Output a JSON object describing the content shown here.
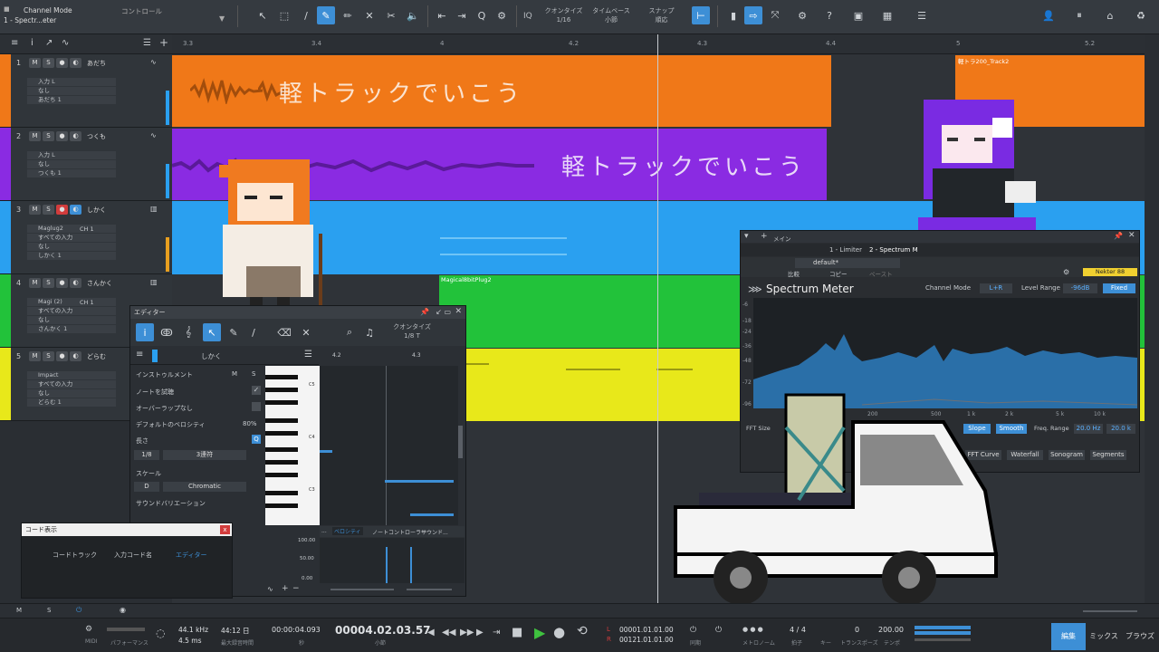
{
  "toolbar": {
    "channel_mode_label": "Channel Mode",
    "channel_mode_value": "1 - Spectr...eter",
    "control_label": "コントロール",
    "quantize_label": "クオンタイズ",
    "quantize_value": "1/16",
    "timebase_label": "タイムベース",
    "timebase_value": "小節",
    "snap_label": "スナップ",
    "snap_value": "順応",
    "iq_label": "IQ"
  },
  "ruler": {
    "ticks": [
      "3.3",
      "3.4",
      "4",
      "4.2",
      "4.3",
      "4.4",
      "5",
      "5.2"
    ]
  },
  "tracks": [
    {
      "num": "1",
      "name": "あだち",
      "color": "#f07818",
      "rows": [
        "入力 L",
        "なし",
        "あだち 1"
      ]
    },
    {
      "num": "2",
      "name": "つくも",
      "color": "#8a2be2",
      "rows": [
        "入力 L",
        "なし",
        "つくも 1"
      ]
    },
    {
      "num": "3",
      "name": "しかく",
      "color": "#2aa0f0",
      "rows": [
        "Maglug2",
        "すべての入力",
        "なし",
        "しかく 1"
      ],
      "ch": "CH 1"
    },
    {
      "num": "4",
      "name": "さんかく",
      "color": "#22c23a",
      "rows": [
        "Magi (2)",
        "すべての入力",
        "なし",
        "さんかく 1"
      ],
      "ch": "CH 1"
    },
    {
      "num": "5",
      "name": "どらむ",
      "color": "#e8e81a",
      "rows": [
        "Impact",
        "すべての入力",
        "なし",
        "どらむ 1"
      ]
    }
  ],
  "clips": {
    "lyric_1": "軽トラックでいこう",
    "lyric_2": "軽トラックでいこう",
    "track2_label": "軽トラ200_Track2",
    "plug2_label": "Magical8bitPlug2"
  },
  "editor": {
    "title": "エディター",
    "quantize_label": "クオンタイズ",
    "quantize_value": "1/8 T",
    "track_name": "しかく",
    "instrument_label": "インストゥルメント",
    "note_preview": "ノートを試聴",
    "overlap": "オーバーラップなし",
    "default_velocity_label": "デフォルトのベロシティ",
    "default_velocity": "80%",
    "length_label": "長さ",
    "length_value": "1/8",
    "triplet_value": "3連符",
    "scale_label": "スケール",
    "scale_root": "D",
    "scale_type": "Chromatic",
    "sound_variation": "サウンドバリエーション",
    "ruler": [
      "4.2",
      "4.3"
    ],
    "key_c5": "C5",
    "key_c4": "C4",
    "key_c3": "C3",
    "tabs": [
      "ベロシティ",
      "ノートコントローラー",
      "サウンド..."
    ],
    "vel_ticks": [
      "100.00",
      "50.00",
      "0.00"
    ]
  },
  "chord": {
    "title": "コード表示",
    "items": [
      "コードトラック",
      "入力コード名",
      "エディター"
    ]
  },
  "spectrum": {
    "top_label": "メイン",
    "tab1": "1 - Limiter",
    "tab2": "2 - Spectrum M",
    "preset": "default*",
    "compare": "比較",
    "copy": "コピー",
    "paste": "ペースト",
    "nekter": "Nekter 88",
    "title": "Spectrum Meter",
    "channel_mode_label": "Channel Mode",
    "channel_mode_value": "L+R",
    "level_range_label": "Level Range",
    "level_range_value": "-96dB",
    "fixed": "Fixed",
    "db_ticks": [
      "-6",
      "-18",
      "-24",
      "-36",
      "-48",
      "-72",
      "-96"
    ],
    "freq_ticks": [
      "100",
      "200",
      "500",
      "1 k",
      "2 k",
      "5 k",
      "10 k"
    ],
    "fft_size": "FFT Size",
    "slope": "Slope",
    "smooth": "Smooth",
    "freq_range_label": "Freq. Range",
    "freq_lo": "20.0 Hz",
    "freq_hi": "20.0 k",
    "fft_curve": "FFT Curve",
    "waterfall": "Waterfall",
    "sonogram": "Sonogram",
    "segments": "Segments"
  },
  "transport": {
    "midi": "MIDI",
    "performance": "パフォーマンス",
    "sample_rate": "44.1 kHz",
    "latency": "4.5 ms",
    "rec_time": "44:12 日",
    "rec_time_label": "最大録音時間",
    "seconds": "00:00:04.093",
    "seconds_label": "秒",
    "bars": "00004.02.03.57",
    "bars_label": "小節",
    "loop_l": "00001.01.01.00",
    "loop_r": "00121.01.01.00",
    "l": "L",
    "r": "R",
    "sync": "同期",
    "metronome": "メトロノーム",
    "sig": "4 / 4",
    "sig_label": "拍子",
    "key_label": "キー",
    "transpose": "0",
    "transpose_label": "トランスポーズ",
    "tempo": "200.00",
    "tempo_label": "テンポ"
  },
  "nav": {
    "edit": "編集",
    "mix": "ミックス",
    "browse": "ブラウズ"
  },
  "colors": {
    "accent": "#3d8fd6",
    "orange": "#f07818",
    "purple": "#8a2be2",
    "blue": "#2aa0f0",
    "green": "#22c23a",
    "yellow": "#e8e81a"
  }
}
